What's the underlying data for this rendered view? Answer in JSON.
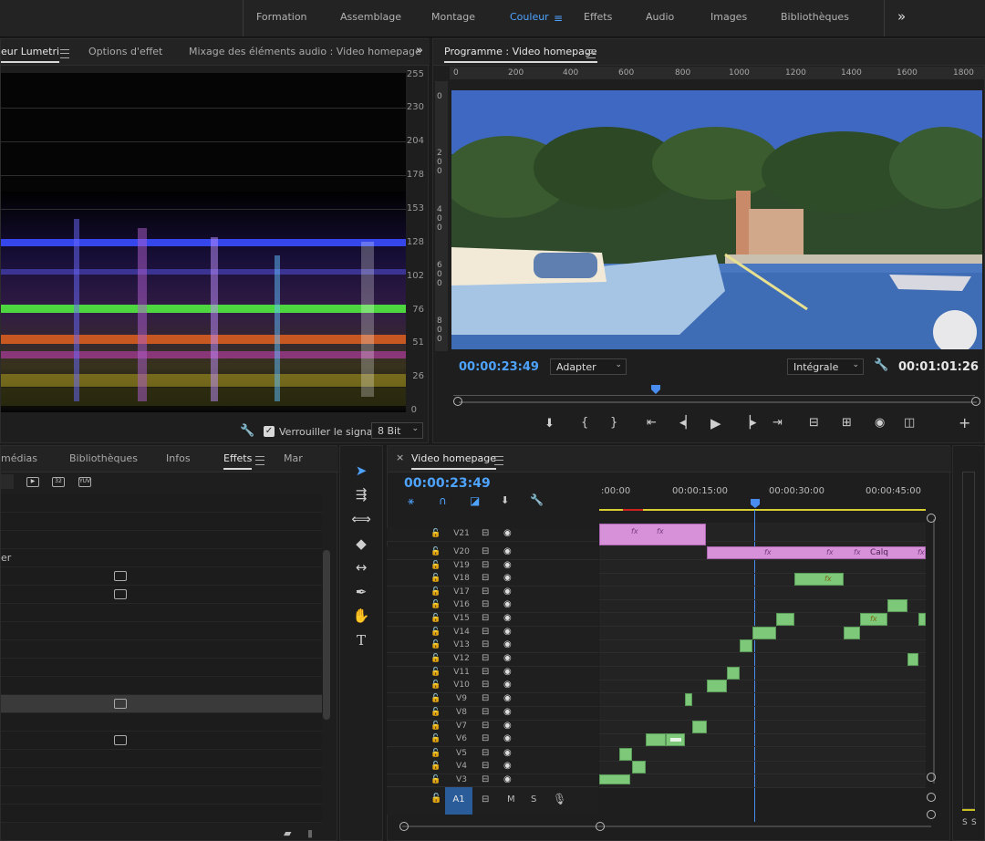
{
  "workspaces": [
    "Formation",
    "Assemblage",
    "Montage",
    "Couleur",
    "Effets",
    "Audio",
    "Images",
    "Bibliothèques"
  ],
  "workspace_active": "Couleur",
  "overflow_glyph": "»",
  "lumetri": {
    "tabs": [
      "eur Lumetri",
      "Options d'effet",
      "Mixage des éléments audio : Video homepage"
    ],
    "scale": [
      "255",
      "230",
      "204",
      "178",
      "153",
      "128",
      "102",
      "76",
      "51",
      "26",
      "0"
    ],
    "lock_label": "Verrouiller le signal",
    "lock_checked": true,
    "bit_depth": "8 Bit"
  },
  "program": {
    "title": "Programme : Video homepage",
    "ruler_h": [
      "0",
      "200",
      "400",
      "600",
      "800",
      "1000",
      "1200",
      "1400",
      "1600",
      "1800"
    ],
    "ruler_v": [
      "0",
      "2 0 0",
      "4 0 0",
      "6 0 0",
      "8 0 0"
    ],
    "timecode": "00:00:23:49",
    "fit_select": "Adapter",
    "quality_select": "Intégrale",
    "duration": "00:01:01:26"
  },
  "effects_panel": {
    "tabs": [
      "médias",
      "Bibliothèques",
      "Infos",
      "Effets",
      "Mar"
    ],
    "toolbar_badges": [
      "32",
      "YUV"
    ],
    "rows_text": [
      "er"
    ]
  },
  "timeline": {
    "tab_title": "Video homepage",
    "close_glyph": "×",
    "timecode": "00:00:23:49",
    "ruler": [
      ":00:00",
      "00:00:15:00",
      "00:00:30:00",
      "00:00:45:00"
    ],
    "tracks": [
      "V21",
      "V20",
      "V19",
      "V18",
      "V17",
      "V16",
      "V15",
      "V14",
      "V13",
      "V12",
      "V11",
      "V10",
      "V9",
      "V8",
      "V7",
      "V6",
      "V5",
      "V4",
      "V3"
    ],
    "audio_track": "A1",
    "audio_buttons": [
      "M",
      "S"
    ],
    "clip_label": "Calq",
    "fx_label": "fx",
    "level_labels": [
      "S",
      "S"
    ]
  },
  "colors": {
    "accent": "#4ea3ff",
    "clip_video": "#7ec87a",
    "clip_adjust": "#d691d9",
    "playhead": "#4a8df0"
  }
}
